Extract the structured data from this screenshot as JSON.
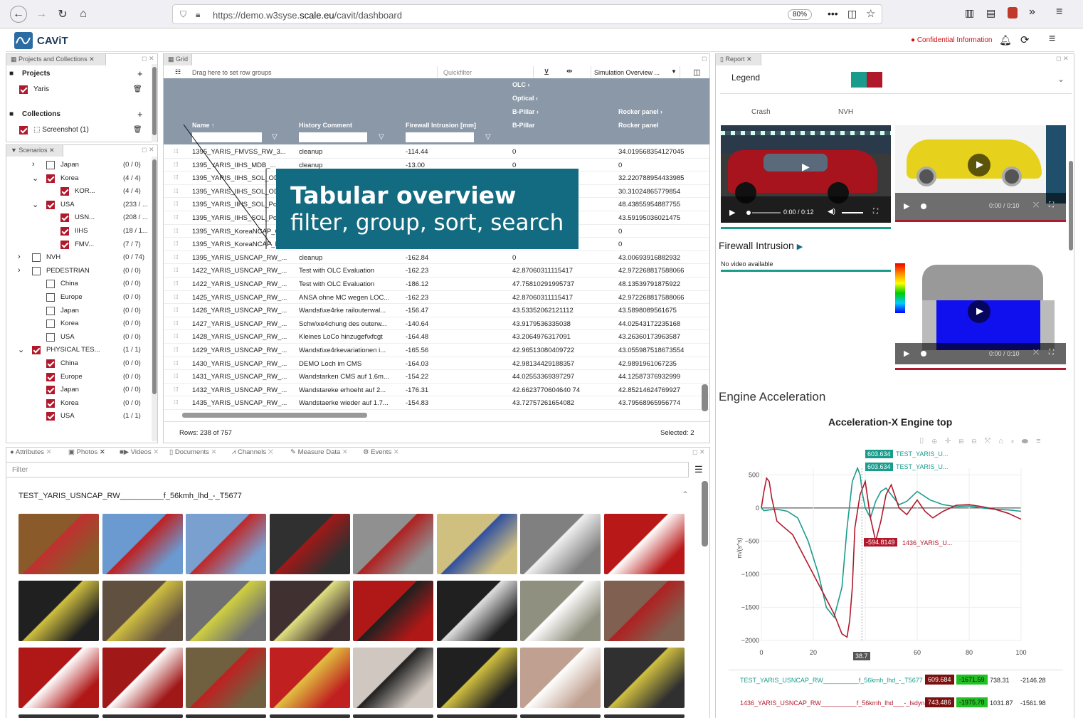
{
  "browser": {
    "url_prefix": "https://demo.w3syse.",
    "url_domain": "scale.eu",
    "url_path": "/cavit/dashboard",
    "zoom": "80%"
  },
  "app": {
    "name": "CAViT",
    "confidential": "Confidential Information"
  },
  "left_panel": {
    "tab": "Projects and Collections",
    "projects_title": "Projects",
    "project_item": "Yaris",
    "collections_title": "Collections",
    "collection_item": "Screenshot (1)"
  },
  "scenarios": {
    "tab": "Scenarios",
    "rows": [
      {
        "label": "Japan",
        "count": "(0 / 0)"
      },
      {
        "label": "Korea",
        "count": "(4 / 4)"
      },
      {
        "label": "KOR...",
        "count": "(4 / 4)"
      },
      {
        "label": "USA",
        "count": "(233 / ..."
      },
      {
        "label": "USN...",
        "count": "(208 / ..."
      },
      {
        "label": "IIHS",
        "count": "(18 / 1..."
      },
      {
        "label": "FMV...",
        "count": "(7 / 7)"
      },
      {
        "label": "NVH",
        "count": "(0 / 74)"
      },
      {
        "label": "PEDESTRIAN",
        "count": "(0 / 0)"
      },
      {
        "label": "China",
        "count": "(0 / 0)"
      },
      {
        "label": "Europe",
        "count": "(0 / 0)"
      },
      {
        "label": "Japan",
        "count": "(0 / 0)"
      },
      {
        "label": "Korea",
        "count": "(0 / 0)"
      },
      {
        "label": "USA",
        "count": "(0 / 0)"
      },
      {
        "label": "PHYSICAL TES...",
        "count": "(1 / 1)"
      },
      {
        "label": "China",
        "count": "(0 / 0)"
      },
      {
        "label": "Europe",
        "count": "(0 / 0)"
      },
      {
        "label": "Japan",
        "count": "(0 / 0)"
      },
      {
        "label": "Korea",
        "count": "(0 / 0)"
      },
      {
        "label": "USA",
        "count": "(1 / 1)"
      }
    ]
  },
  "grid": {
    "tab": "Grid",
    "group_hint": "Drag here to set row groups",
    "quickfilter": "Quickfilter",
    "view_select": "Simulation Overview ...",
    "group_headers": [
      "OLC",
      "Optical",
      "B-Pillar",
      "Rocker panel"
    ],
    "columns": [
      "Name",
      "History Comment",
      "Firewall Intrusion [mm]",
      "B-Pillar",
      "Rocker panel"
    ],
    "rows": [
      [
        "1395_YARIS_FMVSS_RW_3...",
        "cleanup",
        "-114.44",
        "0",
        "34.019568354127045"
      ],
      [
        "1395_YARIS_IIHS_MDB_...",
        "cleanup",
        "-13.00",
        "0",
        "0"
      ],
      [
        "1395_YARIS_IIHS_SOL_ODB...",
        "",
        "",
        "",
        "32.220788954433985"
      ],
      [
        "1395_YARIS_IIHS_SOL_ODB...",
        "",
        "",
        "",
        "30.31024865779854"
      ],
      [
        "1395_YARIS_IIHS_SOL_Pole...",
        "",
        "",
        "",
        "48.43855954887755"
      ],
      [
        "1395_YARIS_IIHS_SOL_Pole...",
        "",
        "",
        "",
        "43.59195036021475"
      ],
      [
        "1395_YARIS_KoreaNCAP_O...",
        "",
        "",
        "",
        "0"
      ],
      [
        "1395_YARIS_KoreaNCAP_R...",
        "",
        "",
        "",
        "0"
      ],
      [
        "1395_YARIS_USNCAP_RW_...",
        "cleanup",
        "-162.84",
        "0",
        "43.00693916882932"
      ],
      [
        "1422_YARIS_USNCAP_RW_...",
        "Test with OLC Evaluation",
        "-162.23",
        "42.87060311115417",
        "42.972268817588066"
      ],
      [
        "1422_YARIS_USNCAP_RW_...",
        "Test with OLC Evaluation",
        "-186.12",
        "47.75810291995737",
        "48.13539791875922"
      ],
      [
        "1425_YARIS_USNCAP_RW_...",
        "ANSA ohne MC wegen LOC...",
        "-162.23",
        "42.87060311115417",
        "42.972268817588066"
      ],
      [
        "1426_YARIS_USNCAP_RW_...",
        "Wandst\\xe4rke railouterwal...",
        "-156.47",
        "43.53352062121112",
        "43.5898089561675"
      ],
      [
        "1427_YARIS_USNCAP_RW_...",
        "Schw\\xe4chung des outerw...",
        "-140.64",
        "43.9179536335038",
        "44.02543172235168"
      ],
      [
        "1428_YARIS_USNCAP_RW_...",
        "Kleines LoCo hinzugef\\xfcgt",
        "-164.48",
        "43.2064976317091",
        "43.26360173963587"
      ],
      [
        "1429_YARIS_USNCAP_RW_...",
        "Wandst\\xe4rkevariationen i...",
        "-165.56",
        "42.96513080409722",
        "43.055987518673554"
      ],
      [
        "1430_YARIS_USNCAP_RW_...",
        "DEMO Loch im CMS",
        "-164.03",
        "42.98134429188357",
        "42.9891961067235"
      ],
      [
        "1431_YARIS_USNCAP_RW_...",
        "Wandstarken CMS auf 1.6m...",
        "-154.22",
        "44.02553369397297",
        "44.12587376932999"
      ],
      [
        "1432_YARIS_USNCAP_RW_...",
        "Wandstareke erhoeht auf 2...",
        "-176.31",
        "42.6623770604640 74",
        "42.85214624769927"
      ],
      [
        "1435_YARIS_USNCAP_RW_...",
        "Wandstaerke wieder auf 1.7...",
        "-154.83",
        "43.72757261654082",
        "43.79568965956774"
      ]
    ],
    "rows_status": "Rows: 238 of 757",
    "selected_status": "Selected: 2"
  },
  "overlay": {
    "title": "Tabular overview",
    "subtitle": "filter, group, sort, search"
  },
  "bottom": {
    "tabs": [
      "Attributes",
      "Photos",
      "Videos",
      "Documents",
      "Channels",
      "Measure Data",
      "Events"
    ],
    "filter_placeholder": "Filter",
    "test_name": "TEST_YARIS_USNCAP_RW__________f_56kmh_lhd_-_T5677"
  },
  "report": {
    "tab": "Report",
    "legend": "Legend",
    "col_crash": "Crash",
    "col_nvh": "NVH",
    "video1_time": "0:00 / 0:12",
    "video2_time": "0:00 / 0:10",
    "video3_time": "0:00 / 0:10",
    "firewall_title": "Firewall Intrusion",
    "no_video": "No video available",
    "engine_title": "Engine Acceleration",
    "chart_title": "Acceleration-X Engine top",
    "label_a": "TEST_YARIS_U...",
    "label_b": "TEST_YARIS_U...",
    "label_c": "1436_YARIS_U...",
    "val_a": "603.634",
    "val_b": "603.634",
    "val_c": "-594.8149",
    "cursor_x": "38.7",
    "ylabel": "m/(s^s)",
    "series_rows": [
      {
        "name": "TEST_YARIS_USNCAP_RW__________f_56kmh_lhd_-_T5677",
        "max": "609.684",
        "min": "-1671.59",
        "v3": "738.31",
        "v4": "-2146.28"
      },
      {
        "name": "1436_YARIS_USNCAP_RW__________f_56kmh_lhd___-_lsdyna",
        "max": "743.486",
        "min": "-1975.78",
        "v3": "1031.87",
        "v4": "-1561.98"
      }
    ]
  },
  "colors": {
    "teal": "#1a9c8c",
    "crimson": "#b0192b",
    "grid_header": "#8a98a8",
    "overlay": "#126b81"
  },
  "chart_data": {
    "type": "line",
    "title": "Acceleration-X Engine top",
    "xlabel": "",
    "ylabel": "m/(s^s)",
    "xlim": [
      0,
      100
    ],
    "ylim": [
      -2000,
      600
    ],
    "x_ticks": [
      0,
      20,
      40,
      60,
      80,
      100
    ],
    "x_tick_labels": [
      "0",
      "20",
      "",
      "60",
      "80",
      "100"
    ],
    "y_ticks": [
      500,
      0,
      -500,
      -1000,
      -1500,
      -2000
    ],
    "y_tick_labels": [
      "500",
      "0",
      "−500",
      "−1000",
      "−1500",
      "−2000"
    ],
    "series": [
      {
        "name": "TEST_YARIS_USNCAP_RW__________f_56kmh_lhd_-_T5677",
        "color": "#1a9c8c",
        "x": [
          0,
          1,
          3,
          6,
          10,
          14,
          18,
          22,
          25,
          28,
          31,
          33,
          35,
          37,
          38,
          39,
          40,
          42,
          44,
          46,
          48,
          50,
          53,
          56,
          60,
          65,
          70,
          75,
          80,
          85,
          90,
          95,
          100
        ],
        "y": [
          0,
          -40,
          -30,
          -20,
          -50,
          -150,
          -500,
          -1000,
          -1500,
          -1650,
          -1200,
          -300,
          400,
          603,
          500,
          200,
          0,
          -150,
          100,
          250,
          300,
          200,
          50,
          100,
          250,
          120,
          50,
          20,
          30,
          0,
          -20,
          -30,
          -50
        ]
      },
      {
        "name": "1436_YARIS_USNCAP_RW__________f_56kmh_lhd___-_lsdyna",
        "color": "#b0192b",
        "x": [
          0,
          1,
          2,
          3,
          4,
          6,
          9,
          12,
          16,
          20,
          24,
          28,
          31,
          33,
          34,
          35,
          36,
          38,
          40,
          42,
          44,
          46,
          48,
          50,
          53,
          56,
          60,
          63,
          66,
          70,
          75,
          80,
          85,
          90,
          95,
          100
        ],
        "y": [
          0,
          250,
          450,
          400,
          150,
          -200,
          -300,
          -400,
          -700,
          -1000,
          -1300,
          -1600,
          -1900,
          -1950,
          -1700,
          -1200,
          -300,
          200,
          400,
          -150,
          -500,
          -200,
          200,
          350,
          0,
          -100,
          120,
          -50,
          -150,
          -50,
          40,
          50,
          20,
          -20,
          -80,
          -170
        ]
      }
    ]
  }
}
